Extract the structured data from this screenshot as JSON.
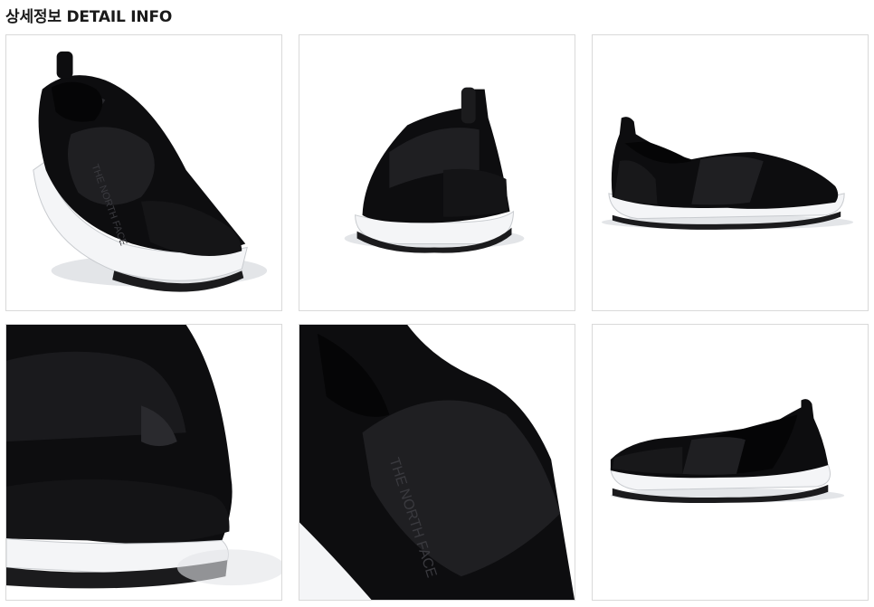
{
  "section": {
    "title": "상세정보 DETAIL INFO"
  },
  "product": {
    "colors": {
      "upper": "#0d0d0f",
      "upper_highlight": "#1f1f22",
      "sole": "#f4f5f7",
      "outsole": "#1b1b1d",
      "shadow": "#cfd2d6",
      "border": "#d9d9d9"
    },
    "logo_text": "THE NORTH FACE"
  }
}
